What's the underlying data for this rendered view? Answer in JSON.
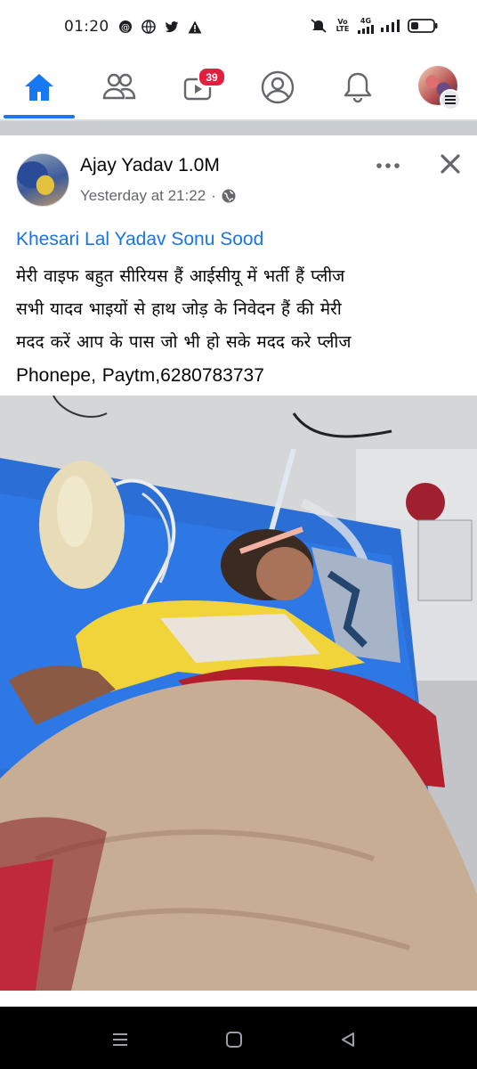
{
  "status_bar": {
    "time": "01:20",
    "icons": [
      "threads-icon",
      "globe-icon",
      "twitter-icon",
      "warning-icon",
      "mute-icon",
      "volte-icon",
      "network-4g-icon",
      "signal-icon",
      "battery-icon"
    ],
    "volte_label": "Vo LTE",
    "network_label": "4G"
  },
  "nav": {
    "items": [
      "home-icon",
      "friends-icon",
      "watch-icon",
      "profile-icon",
      "notifications-icon",
      "menu-avatar"
    ],
    "watch_badge": "39",
    "accent": "#1877f2",
    "badge_color": "#e41e3f"
  },
  "post": {
    "author": "Ajay Yadav 1.0M",
    "timestamp": "Yesterday at 21:22",
    "separator": "·",
    "tags": "Khesari Lal Yadav Sonu Sood",
    "lines": [
      "मेरी वाइफ बहुत सीरियस हैं आईसीयू में भर्ती हैं प्लीज",
      "सभी यादव भाइयों से हाथ जोड़ के निवेदन हैं की मेरी",
      "मदद करें आप के पास जो भी हो सके मदद करे प्लीज",
      "Phonepe, Paytm,6280783737"
    ],
    "tag_color": "#1b74e4"
  }
}
